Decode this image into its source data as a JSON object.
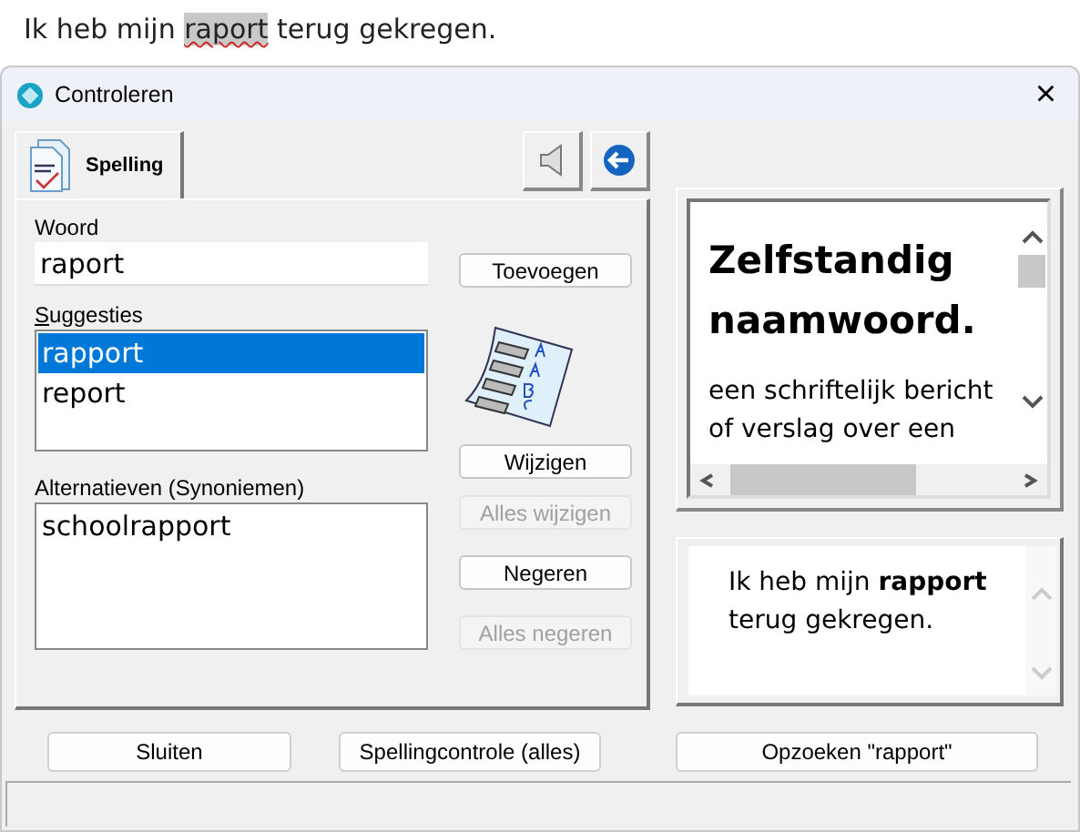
{
  "document": {
    "before": "Ik heb mijn ",
    "highlighted": "raport",
    "after": " terug gekregen."
  },
  "window": {
    "title": "Controleren",
    "close": "×"
  },
  "tabs": [
    {
      "label": "Spelling",
      "selected": true
    }
  ],
  "word": {
    "label": "Woord",
    "value": "raport"
  },
  "suggestions": {
    "label": "Suggesties",
    "items": [
      {
        "text": "rapport",
        "selected": true
      },
      {
        "text": "report",
        "selected": false
      }
    ]
  },
  "alternatives": {
    "label": "Alternatieven (Synoniemen)",
    "items": [
      {
        "text": "schoolrapport",
        "selected": false
      }
    ]
  },
  "side_buttons": [
    {
      "label": "Toevoegen",
      "disabled": false
    },
    {
      "label": "Wijzigen",
      "disabled": false
    },
    {
      "label": "Alles wijzigen",
      "disabled": true
    },
    {
      "label": "Negeren",
      "disabled": false
    },
    {
      "label": "Alles negeren",
      "disabled": true
    }
  ],
  "definition": {
    "title": "Zelfstandig naamwoord.",
    "text": "een schriftelijk bericht of verslag over een"
  },
  "example": {
    "text": "Ik heb mijn **rapport** terug gekregen."
  },
  "bottom_buttons": [
    {
      "label": "Sluiten"
    },
    {
      "label": "Spellingcontrole (alles)"
    },
    {
      "label": "Opzoeken \"rapport\""
    }
  ]
}
